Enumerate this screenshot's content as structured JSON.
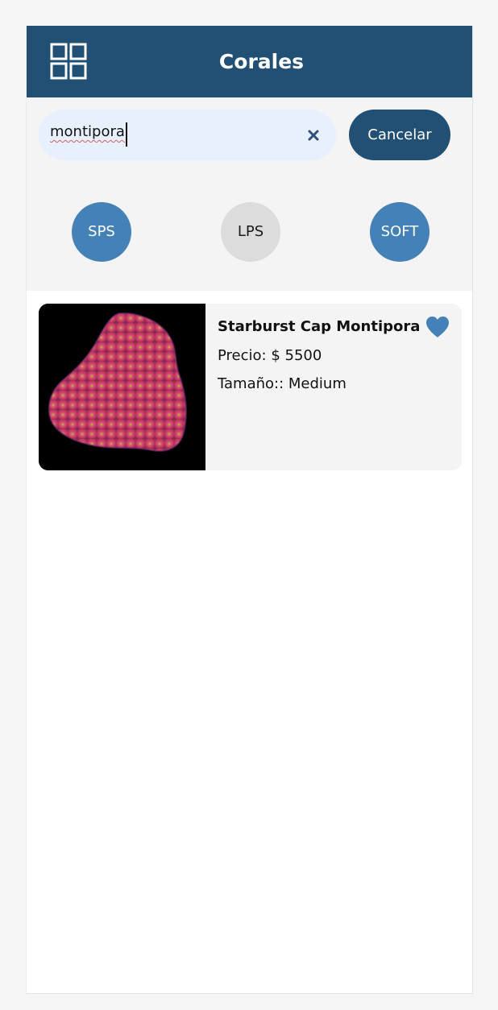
{
  "header": {
    "title": "Corales",
    "menu_icon": "grid-icon"
  },
  "search": {
    "value": "montipora",
    "clear_icon": "close-icon",
    "cancel_label": "Cancelar"
  },
  "categories": [
    {
      "label": "SPS",
      "selected": false
    },
    {
      "label": "LPS",
      "selected": true
    },
    {
      "label": "SOFT",
      "selected": false
    }
  ],
  "results": [
    {
      "name": "Starburst Cap Montipora",
      "price": "Precio: $ 5500",
      "size": "Tamaño:: Medium",
      "favorite_icon": "heart-icon",
      "favorited": true
    }
  ],
  "colors": {
    "primary": "#224f74",
    "accent": "#4381b6",
    "inactive": "#dcdcdc",
    "search_bg": "#e8f0fd"
  }
}
